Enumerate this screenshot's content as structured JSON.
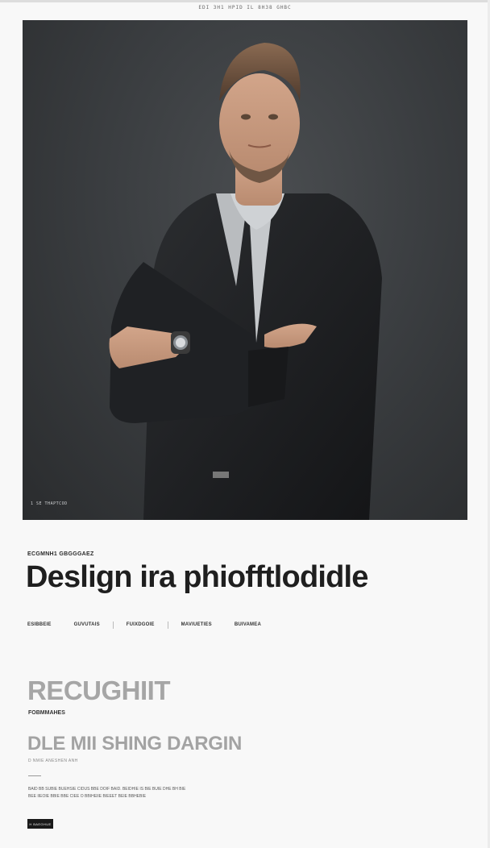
{
  "header": {
    "caption": "EDI 3H1 HPID IL 8H38 GHBC"
  },
  "hero": {
    "image_alt": "Man in dark suit with arms crossed",
    "caption": "1 SE THAPTCOD"
  },
  "intro": {
    "eyebrow": "ECGMNH1 GBGGGAEZ",
    "headline": "Deslign ira phiofftlodidle"
  },
  "nav": {
    "items": [
      "ESIBBEIE",
      "GUVUTAIS",
      "FUIXDGOIE",
      "MAVIUETIES",
      "BUIVAMEA"
    ]
  },
  "section": {
    "title": "RECUGHIIT",
    "subtitle": "FOBMMAHES",
    "heading": "DLE MII SHING DARGIN",
    "meta": "D NMIE ANESHEN ANH",
    "body": "BAID BB SUBIE BUEHSIE CIDUS BBE DOIF BAID. BEIDHIE IS BIE BUIE DHE BH BIE BEE IIEOIE BBIE BBE CIEE O BBIHEIIE BIEEET BEIE BBHEBIE",
    "cta_label": "H BAEGHUE"
  }
}
